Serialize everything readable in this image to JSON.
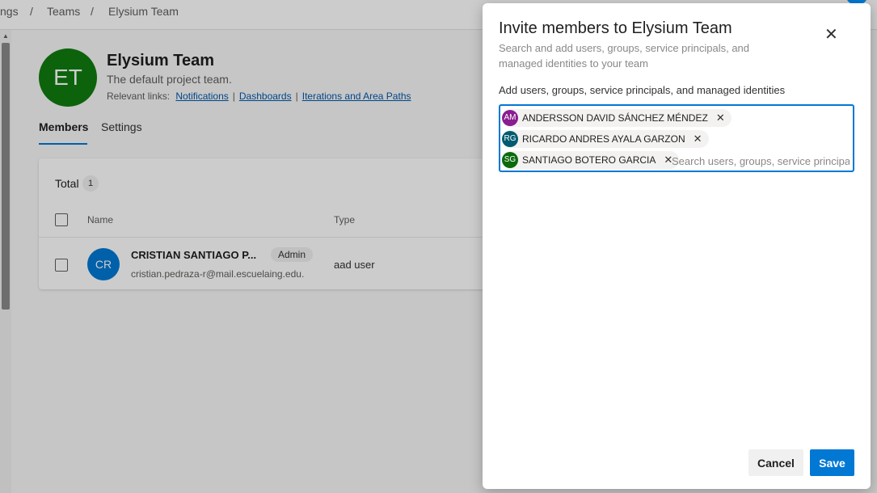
{
  "breadcrumb": {
    "item1": "ngs",
    "sep": "/",
    "item2": "Teams",
    "item3": "Elysium Team"
  },
  "team": {
    "initials": "ET",
    "name": "Elysium Team",
    "description": "The default project team.",
    "relevant_links_label": "Relevant links:",
    "links": [
      "Notifications",
      "Dashboards",
      "Iterations and Area Paths"
    ]
  },
  "tabs": {
    "members": "Members",
    "settings": "Settings"
  },
  "members_card": {
    "total_label": "Total",
    "total_count": "1",
    "columns": {
      "name": "Name",
      "type": "Type"
    },
    "rows": [
      {
        "initials": "CR",
        "name": "CRISTIAN SANTIAGO P...",
        "badge": "Admin",
        "email": "cristian.pedraza-r@mail.escuelaing.edu.",
        "type": "aad user"
      }
    ]
  },
  "dialog": {
    "title": "Invite members to Elysium Team",
    "subtitle": "Search and add users, groups, service principals, and managed identities to your team",
    "field_label": "Add users, groups, service principals, and managed identities",
    "search_placeholder": "Search users, groups, service principals",
    "chips": [
      {
        "initials": "AM",
        "name": "ANDERSSON DAVID SÁNCHEZ MÉNDEZ",
        "color": "#8a1d8f"
      },
      {
        "initials": "RG",
        "name": "RICARDO ANDRES AYALA GARZON",
        "color": "#005b70"
      },
      {
        "initials": "SG",
        "name": "SANTIAGO BOTERO GARCIA",
        "color": "#0b6a0b"
      }
    ],
    "cancel_label": "Cancel",
    "save_label": "Save"
  },
  "colors": {
    "accent": "#0078d4",
    "team_avatar": "#107c10"
  }
}
